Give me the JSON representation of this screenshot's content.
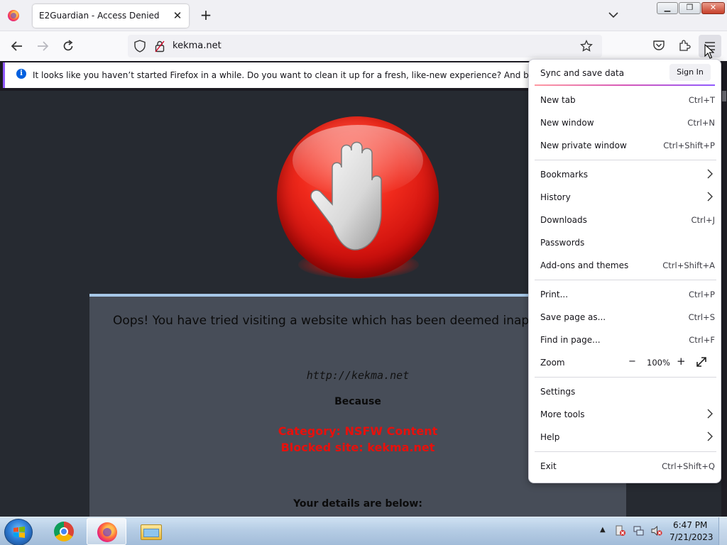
{
  "browser": {
    "tab_title": "E2Guardian - Access Denied",
    "url": "kekma.net",
    "notification": "It looks like you haven’t started Firefox in a while. Do you want to clean it up for a fresh, like-new experience? And by the way, welcome back!"
  },
  "page": {
    "headline": "Oops! You have tried visiting a website which has been deemed inappropriate",
    "blocked_url": "http://kekma.net",
    "because": "Because",
    "category": "Category: NSFW Content",
    "blocked_site": "Blocked site: kekma.net",
    "details_heading": "Your details are below:"
  },
  "menu": {
    "sync_label": "Sync and save data",
    "sign_in": "Sign In",
    "items": [
      {
        "label": "New tab",
        "shortcut": "Ctrl+T"
      },
      {
        "label": "New window",
        "shortcut": "Ctrl+N"
      },
      {
        "label": "New private window",
        "shortcut": "Ctrl+Shift+P"
      },
      {
        "label": "Bookmarks",
        "shortcut": ""
      },
      {
        "label": "History",
        "shortcut": ""
      },
      {
        "label": "Downloads",
        "shortcut": "Ctrl+J"
      },
      {
        "label": "Passwords",
        "shortcut": ""
      },
      {
        "label": "Add-ons and themes",
        "shortcut": "Ctrl+Shift+A"
      },
      {
        "label": "Print...",
        "shortcut": "Ctrl+P"
      },
      {
        "label": "Save page as...",
        "shortcut": "Ctrl+S"
      },
      {
        "label": "Find in page...",
        "shortcut": "Ctrl+F"
      },
      {
        "label": "Zoom",
        "shortcut": ""
      },
      {
        "label": "Settings",
        "shortcut": ""
      },
      {
        "label": "More tools",
        "shortcut": ""
      },
      {
        "label": "Help",
        "shortcut": ""
      },
      {
        "label": "Exit",
        "shortcut": "Ctrl+Shift+Q"
      }
    ],
    "zoom": {
      "minus": "−",
      "value": "100%",
      "plus": "+"
    }
  },
  "taskbar": {
    "time": "6:47 PM",
    "date": "7/21/2023"
  },
  "colors": {
    "accent": "#9059ff",
    "block_red": "#e8100c",
    "page_bg": "#262a31",
    "panel_bg": "#474d58"
  },
  "icons": [
    "firefox-icon",
    "close-icon",
    "plus-icon",
    "chevron-down-icon",
    "back-icon",
    "forward-icon",
    "reload-icon",
    "shield-icon",
    "lock-icon",
    "star-icon",
    "pocket-icon",
    "extensions-icon",
    "hamburger-icon",
    "info-icon",
    "stop-hand-icon",
    "chevron-right-icon",
    "fullscreen-icon",
    "windows-start-icon",
    "chrome-icon",
    "folder-icon"
  ]
}
